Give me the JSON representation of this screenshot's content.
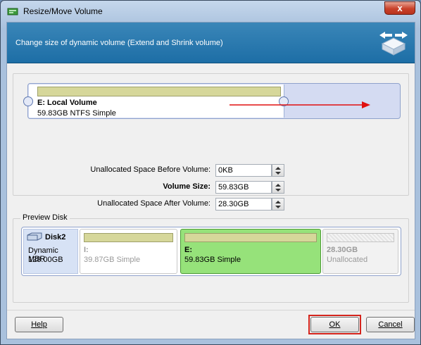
{
  "window": {
    "title": "Resize/Move Volume",
    "close_label": "x"
  },
  "header": {
    "text": "Change size of dynamic volume (Extend and Shrink volume)"
  },
  "volume": {
    "name": "E: Local Volume",
    "desc": "59.83GB NTFS Simple"
  },
  "fields": {
    "before_label": "Unallocated Space Before Volume:",
    "before_value": "0KB",
    "size_label": "Volume Size:",
    "size_value": "59.83GB",
    "after_label": "Unallocated Space After Volume:",
    "after_value": "28.30GB"
  },
  "preview": {
    "legend": "Preview Disk",
    "disk_name": "Disk2",
    "disk_type": "Dynamic MBR",
    "disk_size": "128.00GB",
    "partitions": [
      {
        "name": "I:",
        "desc": "39.87GB Simple"
      },
      {
        "name": "E:",
        "desc": "59.83GB Simple"
      },
      {
        "name": "28.30GB",
        "desc": "Unallocated"
      }
    ]
  },
  "buttons": {
    "help": "Help",
    "ok": "OK",
    "cancel": "Cancel"
  },
  "colors": {
    "header": "#1d6ea6",
    "selected_partition": "#96e27a",
    "highlight": "#d4241c"
  },
  "icons": [
    "app-icon",
    "resize-volume-icon",
    "disk-icon",
    "close-icon"
  ]
}
